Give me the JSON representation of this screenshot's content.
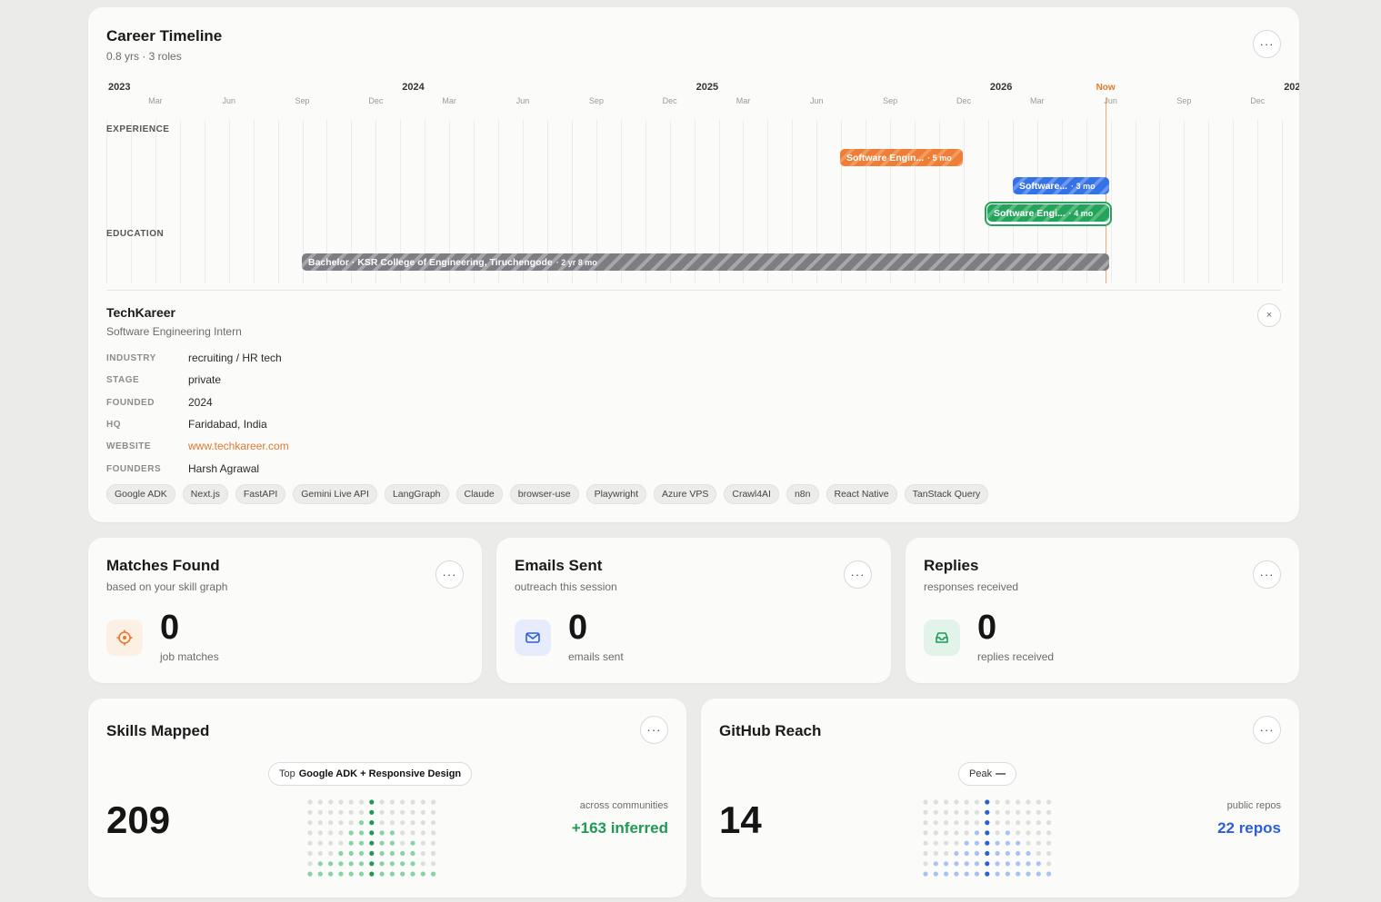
{
  "timeline": {
    "title": "Career Timeline",
    "subtitle": "0.8 yrs · 3 roles",
    "years": [
      {
        "label": "2023",
        "pos": 0
      },
      {
        "label": "2024",
        "pos": 1
      },
      {
        "label": "2025",
        "pos": 2
      },
      {
        "label": "2026",
        "pos": 3
      },
      {
        "label": "202",
        "pos": 4
      }
    ],
    "months": [
      "Mar",
      "Jun",
      "Sep",
      "Dec"
    ],
    "now_label": "Now",
    "sections": {
      "experience": "EXPERIENCE",
      "education": "EDUCATION"
    },
    "bars": {
      "orange": {
        "label": "Software Engin...",
        "duration": "· 5 mo"
      },
      "blue": {
        "label": "Software...",
        "duration": "· 3 mo"
      },
      "green": {
        "label": "Software Engi...",
        "duration": "· 4 mo"
      },
      "edu": {
        "label": "Bachelor · KSR College of Engineering, Tiruchengode",
        "duration": "· 2 yr 8 mo"
      }
    }
  },
  "detail": {
    "company": "TechKareer",
    "role": "Software Engineering Intern",
    "close_label": "×",
    "fields": [
      {
        "key": "INDUSTRY",
        "value": "recruiting / HR tech"
      },
      {
        "key": "STAGE",
        "value": "private"
      },
      {
        "key": "FOUNDED",
        "value": "2024"
      },
      {
        "key": "HQ",
        "value": "Faridabad, India"
      },
      {
        "key": "WEBSITE",
        "value": "www.techkareer.com"
      },
      {
        "key": "FOUNDERS",
        "value": "Harsh Agrawal"
      }
    ],
    "tags": [
      "Google ADK",
      "Next.js",
      "FastAPI",
      "Gemini Live API",
      "LangGraph",
      "Claude",
      "browser-use",
      "Playwright",
      "Azure VPS",
      "Crawl4AI",
      "n8n",
      "React Native",
      "TanStack Query"
    ]
  },
  "more_label": "···",
  "matches": {
    "title": "Matches Found",
    "subtitle": "based on your skill graph",
    "value": "0",
    "caption": "job matches",
    "icon": "target-icon"
  },
  "emails": {
    "title": "Emails Sent",
    "subtitle": "outreach this session",
    "value": "0",
    "caption": "emails sent",
    "icon": "mail-icon"
  },
  "replies": {
    "title": "Replies",
    "subtitle": "responses received",
    "value": "0",
    "caption": "replies received",
    "icon": "inbox-icon"
  },
  "skills": {
    "title": "Skills Mapped",
    "value": "209",
    "pill_prefix": "Top",
    "pill_value": "Google ADK + Responsive Design",
    "side_caption": "across communities",
    "side_value": "+163 inferred",
    "accent": "#1f9a55"
  },
  "github": {
    "title": "GitHub Reach",
    "value": "14",
    "pill_prefix": "Peak",
    "pill_value": "—",
    "side_caption": "public repos",
    "side_value": "22 repos",
    "accent": "#2c5fd6"
  }
}
